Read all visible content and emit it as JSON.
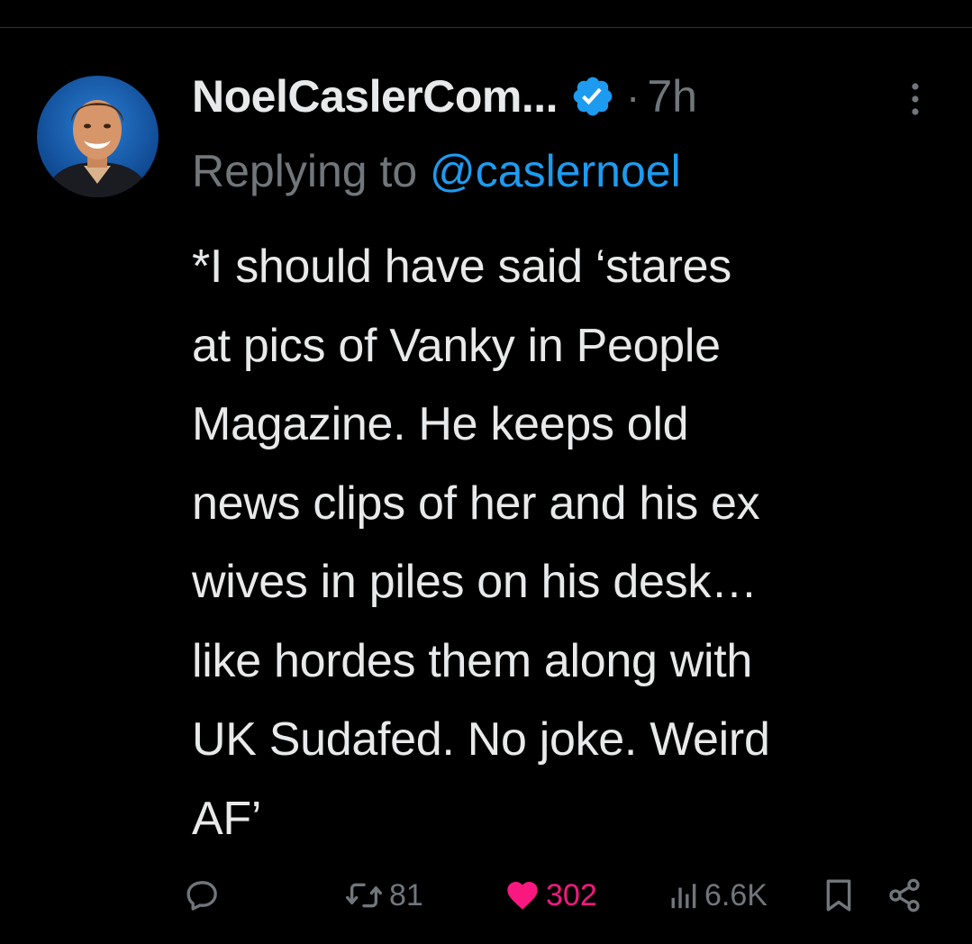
{
  "tweet": {
    "author": {
      "display_name": "NoelCaslerCom...",
      "verified": true
    },
    "separator": "·",
    "time": "7h",
    "reply": {
      "prefix": "Replying to ",
      "handle": "@caslernoel"
    },
    "text_lines": [
      "*I should have said ‘stares",
      "at pics of Vanky in People",
      "Magazine. He keeps old",
      "news clips of her and his ex",
      "wives in piles on his desk…",
      "like hordes them along with",
      "UK Sudafed. No joke. Weird",
      "AF’"
    ],
    "actions": {
      "reply_icon": "reply-icon",
      "retweet_icon": "retweet-icon",
      "retweet_count": "81",
      "like_icon": "heart-filled-icon",
      "like_count": "302",
      "liked": true,
      "views_icon": "views-bar-chart-icon",
      "views_count": "6.6K",
      "bookmark_icon": "bookmark-icon",
      "share_icon": "share-icon"
    }
  },
  "colors": {
    "background": "#000000",
    "text_primary": "#e7e9ea",
    "text_secondary": "#71767b",
    "link": "#1d9bf0",
    "like": "#f91880",
    "verified": "#1d9bf0",
    "divider": "#2f3336"
  }
}
